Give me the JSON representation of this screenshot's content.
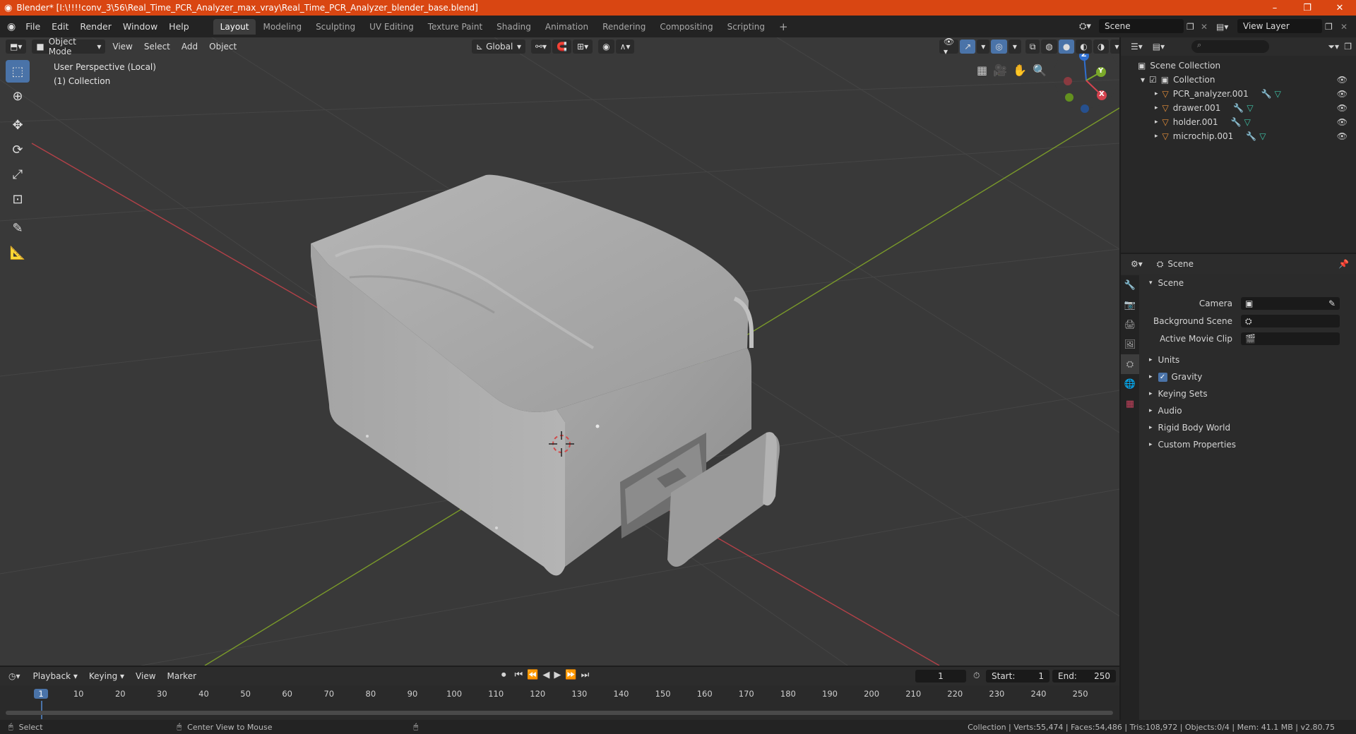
{
  "window": {
    "title": "Blender* [I:\\!!!!conv_3\\56\\Real_Time_PCR_Analyzer_max_vray\\Real_Time_PCR_Analyzer_blender_base.blend]",
    "minimize": "–",
    "maximize": "❐",
    "close": "✕"
  },
  "menu": [
    "File",
    "Edit",
    "Render",
    "Window",
    "Help"
  ],
  "workspaces": [
    "Layout",
    "Modeling",
    "Sculpting",
    "UV Editing",
    "Texture Paint",
    "Shading",
    "Animation",
    "Rendering",
    "Compositing",
    "Scripting"
  ],
  "active_workspace": "Layout",
  "add_workspace": "+",
  "scene_name": "Scene",
  "view_layer": "View Layer",
  "viewport_header": {
    "mode": "Object Mode",
    "menus": [
      "View",
      "Select",
      "Add",
      "Object"
    ],
    "orientation": "Global"
  },
  "viewport_overlay": {
    "perspective": "User Perspective (Local)",
    "collection": "(1) Collection"
  },
  "gizmo": {
    "z": "Z",
    "y": "Y",
    "x": "X"
  },
  "outliner": {
    "root": "Scene Collection",
    "collection": "Collection",
    "objects": [
      "PCR_analyzer.001",
      "drawer.001",
      "holder.001",
      "microchip.001"
    ]
  },
  "properties": {
    "header": "Scene",
    "panel": "Scene",
    "fields": [
      {
        "label": "Camera"
      },
      {
        "label": "Background Scene"
      },
      {
        "label": "Active Movie Clip"
      }
    ],
    "sections": [
      "Units",
      "Gravity",
      "Keying Sets",
      "Audio",
      "Rigid Body World",
      "Custom Properties"
    ]
  },
  "timeline": {
    "menus": [
      "Playback",
      "Keying",
      "View",
      "Marker"
    ],
    "current_frame": "1",
    "start_label": "Start:",
    "start": "1",
    "end_label": "End:",
    "end": "250",
    "ticks": [
      "1",
      "10",
      "20",
      "30",
      "40",
      "50",
      "60",
      "70",
      "80",
      "90",
      "100",
      "110",
      "120",
      "130",
      "140",
      "150",
      "160",
      "170",
      "180",
      "190",
      "200",
      "210",
      "220",
      "230",
      "240",
      "250"
    ]
  },
  "status": {
    "left": "Select",
    "middle": "Center View to Mouse",
    "right": "Collection | Verts:55,474 | Faces:54,486 | Tris:108,972 | Objects:0/4 | Mem: 41.1 MB | v2.80.75"
  },
  "colors": {
    "titlebar": "#d94612",
    "accent": "#4a73a8",
    "x_axis": "#d5434f",
    "y_axis": "#8ab027"
  }
}
